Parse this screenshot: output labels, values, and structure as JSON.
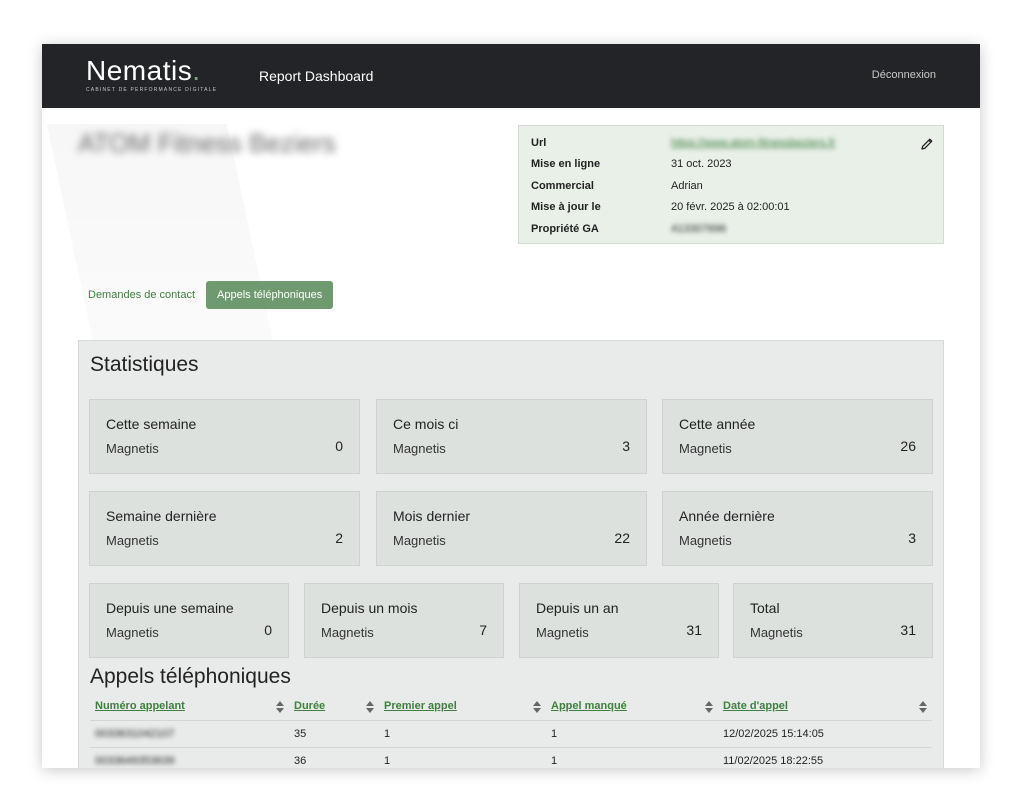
{
  "navbar": {
    "logo_word": "Nematis",
    "logo_tagline": "CABINET DE PERFORMANCE DIGITALE",
    "title": "Report Dashboard",
    "logout": "Déconnexion"
  },
  "client": {
    "name": "ATOM Fitness Beziers"
  },
  "info": {
    "rows": [
      {
        "label": "Url",
        "value": "https://www.atom-fitnessbeziers.fr"
      },
      {
        "label": "Mise en ligne",
        "value": "31 oct. 2023"
      },
      {
        "label": "Commercial",
        "value": "Adrian"
      },
      {
        "label": "Mise à jour le",
        "value": "20 févr. 2025 à 02:00:01"
      },
      {
        "label": "Propriété GA",
        "value": "413307696"
      }
    ],
    "edit_icon": "pencil-icon"
  },
  "tabs": {
    "contact": "Demandes de contact",
    "calls": "Appels téléphoniques"
  },
  "stats": {
    "title": "Statistiques",
    "cards": [
      {
        "title": "Cette semaine",
        "sub": "Magnetis",
        "value": "0"
      },
      {
        "title": "Ce mois ci",
        "sub": "Magnetis",
        "value": "3"
      },
      {
        "title": "Cette année",
        "sub": "Magnetis",
        "value": "26"
      },
      {
        "title": "Semaine dernière",
        "sub": "Magnetis",
        "value": "2"
      },
      {
        "title": "Mois dernier",
        "sub": "Magnetis",
        "value": "22"
      },
      {
        "title": "Année dernière",
        "sub": "Magnetis",
        "value": "3"
      },
      {
        "title": "Depuis une semaine",
        "sub": "Magnetis",
        "value": "0"
      },
      {
        "title": "Depuis un mois",
        "sub": "Magnetis",
        "value": "7"
      },
      {
        "title": "Depuis un an",
        "sub": "Magnetis",
        "value": "31"
      },
      {
        "title": "Total",
        "sub": "Magnetis",
        "value": "31"
      }
    ]
  },
  "calls": {
    "title": "Appels téléphoniques",
    "columns": [
      "Numéro appelant",
      "Durée",
      "Premier appel",
      "Appel manqué",
      "Date d'appel"
    ],
    "rows": [
      [
        "0033631042107",
        "35",
        "1",
        "1",
        "12/02/2025 15:14:05"
      ],
      [
        "0033649353639",
        "36",
        "1",
        "1",
        "11/02/2025 18:22:55"
      ]
    ]
  }
}
